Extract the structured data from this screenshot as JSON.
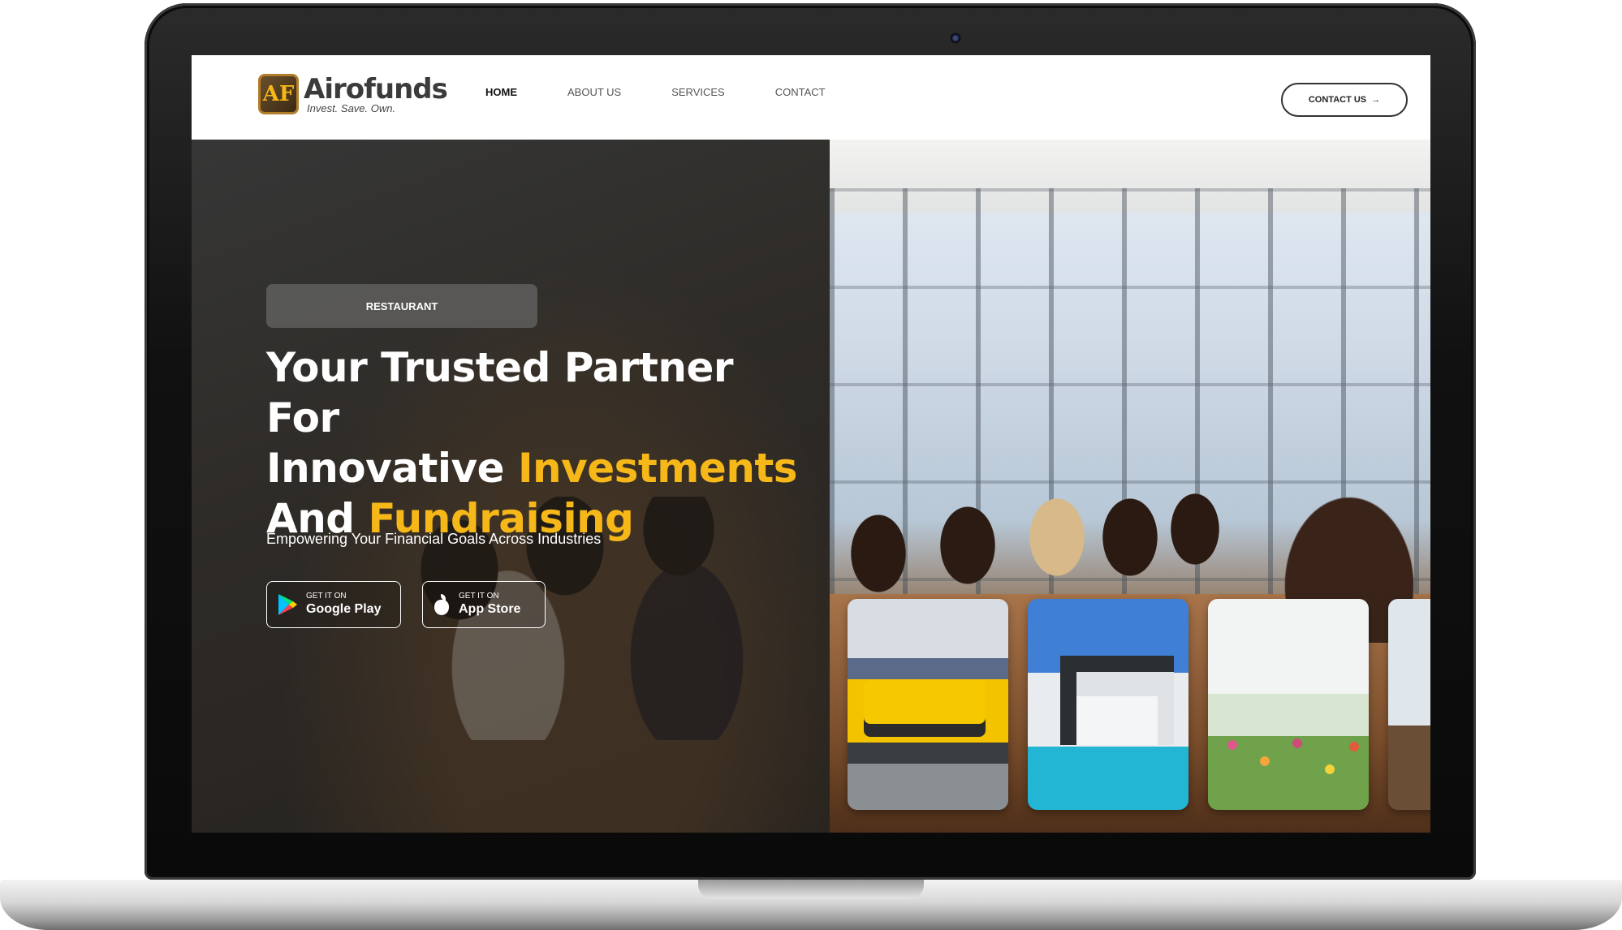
{
  "brand": {
    "name": "Airofunds",
    "tagline": "Invest. Save. Own.",
    "mark": "AF"
  },
  "nav": {
    "items": [
      {
        "label": "HOME",
        "active": true
      },
      {
        "label": "ABOUT US",
        "active": false
      },
      {
        "label": "SERVICES",
        "active": false
      },
      {
        "label": "CONTACT",
        "active": false
      }
    ],
    "cta_label": "CONTACT US",
    "cta_arrow": "→"
  },
  "hero": {
    "category": "RESTAURANT",
    "headline": {
      "line1": "Your Trusted Partner For",
      "line2_plain": "Innovative ",
      "line2_highlight": "Investments",
      "line3_plain": "And ",
      "line3_highlight": "Fundraising"
    },
    "subheadline": "Empowering Your Financial Goals Across Industries",
    "google_play": {
      "small": "GET IT ON",
      "big": "Google Play"
    },
    "app_store": {
      "small": "GET IT ON",
      "big": "App Store"
    }
  },
  "colors": {
    "accent": "#f6b818",
    "text_dark": "#222222",
    "text_light": "#ffffff"
  },
  "icons": {
    "google_play": "google-play-icon",
    "apple": "apple-icon",
    "arrow": "arrow-right-icon"
  }
}
